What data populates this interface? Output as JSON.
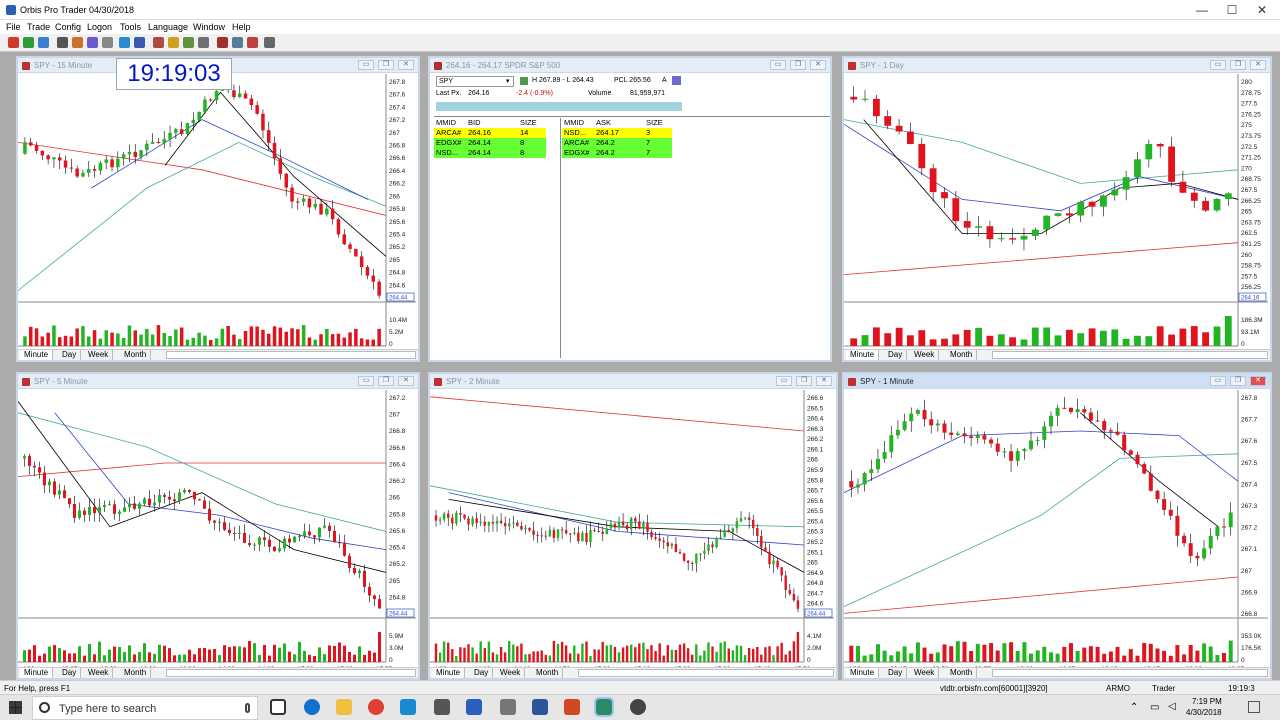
{
  "window": {
    "title": "Orbis Pro Trader  04/30/2018",
    "controls": [
      "—",
      "☐",
      "✕"
    ]
  },
  "menu": [
    "File",
    "Trade",
    "Config",
    "Logon",
    "Tools",
    "Language",
    "Window",
    "Help"
  ],
  "clock": "19:19:03",
  "tabs": [
    "Minute",
    "Day",
    "Week",
    "Month"
  ],
  "panel_buttons": [
    "▭",
    "❐",
    "✕"
  ],
  "panels": {
    "p1": {
      "title": "SPY - 15 Minute",
      "yticks": [
        "267.8",
        "267.6",
        "267.4",
        "267.2",
        "267",
        "266.8",
        "266.6",
        "266.4",
        "266.2",
        "266",
        "265.8",
        "265.6",
        "265.4",
        "265.2",
        "265",
        "264.8",
        "264.6",
        "264.4"
      ],
      "price_tag": "264.44",
      "vol_ticks": [
        "10.4M",
        "5.2M",
        "0"
      ],
      "xticks": [
        "4/27",
        "11:00",
        "13:00",
        "15:00",
        "4/30",
        "11:00",
        "13:00",
        "15:00"
      ]
    },
    "p2": {
      "title": "264.16 - 264.17   SPDR S&P 500"
    },
    "p3": {
      "title": "SPY - 1 Day",
      "yticks": [
        "280",
        "278.75",
        "277.5",
        "276.25",
        "275",
        "273.75",
        "272.5",
        "271.25",
        "270",
        "268.75",
        "267.5",
        "266.25",
        "265",
        "263.75",
        "262.5",
        "261.25",
        "260",
        "258.75",
        "257.5",
        "256.25",
        "255"
      ],
      "price_tag": "264.16",
      "vol_ticks": [
        "186.3M",
        "93.1M",
        "0"
      ],
      "xticks": [
        "3/13",
        "14",
        "15",
        "16",
        "19",
        "20",
        "21",
        "22",
        "23",
        "26",
        "27",
        "28",
        "29",
        "2",
        "3",
        "4",
        "5",
        "6",
        "9",
        "10",
        "11",
        "12",
        "13",
        "16",
        "17",
        "18",
        "19",
        "20",
        "23",
        "24",
        "25",
        "26",
        "27",
        "30"
      ],
      "xnote": "3/18",
      "month_label": "APR"
    },
    "p4": {
      "title": "SPY - 5 Minute",
      "yticks": [
        "267.2",
        "267",
        "266.8",
        "266.6",
        "266.4",
        "266.2",
        "266",
        "265.8",
        "265.6",
        "265.4",
        "265.2",
        "265",
        "264.8",
        "264.6"
      ],
      "price_tag": "264.44",
      "vol_ticks": [
        "5.9M",
        "3.0M",
        "0"
      ],
      "xticks": [
        "4/30",
        "12:05",
        "12:30",
        "13:00",
        "13:30",
        "14:00",
        "14:30",
        "15:00",
        "15:30",
        "15:55"
      ]
    },
    "p5": {
      "title": "SPY - 2 Minute",
      "yticks": [
        "266.6",
        "266.5",
        "266.4",
        "266.3",
        "266.2",
        "266.1",
        "266",
        "265.9",
        "265.8",
        "265.7",
        "265.6",
        "265.5",
        "265.4",
        "265.3",
        "265.2",
        "265.1",
        "265",
        "264.9",
        "264.8",
        "264.7",
        "264.6",
        "264.5"
      ],
      "price_tag": "264.44",
      "vol_ticks": [
        "4.1M",
        "2.0M",
        "0"
      ],
      "xticks": [
        "4/30",
        "14:30",
        "14:40",
        "14:50",
        "15:00",
        "15:10",
        "15:20",
        "15:30",
        "15:40",
        "15:50"
      ]
    },
    "p6": {
      "title": "SPY - 1 Minute",
      "yticks": [
        "267.8",
        "267.7",
        "267.6",
        "267.5",
        "267.4",
        "267.3",
        "267.2",
        "267.1",
        "267",
        "266.9",
        "266.8"
      ],
      "vol_ticks": [
        "353.0K",
        "176.5K",
        "0"
      ],
      "xticks": [
        "4/30",
        "09:45",
        "09:50",
        "09:55",
        "10:00",
        "10:05",
        "10:10",
        "10:15",
        "10:20",
        "10:25"
      ]
    }
  },
  "quote": {
    "symbol": "SPY",
    "high_low": "H 267.89 - L 264.43",
    "pcl": "PCL 265.56",
    "flag": "A",
    "last_label": "Last Px.",
    "last": "264.16",
    "change": "-2.4  (-0.9%)",
    "volume_label": "Volume",
    "volume": "81,959,971",
    "bid_headers": [
      "MMID",
      "BID",
      "SIZE"
    ],
    "bids": [
      [
        "ARCA#",
        "264.16",
        "14"
      ],
      [
        "EDGX#",
        "264.14",
        "8"
      ],
      [
        "NSD...",
        "264.14",
        "8"
      ]
    ],
    "ask_headers": [
      "MMID",
      "ASK",
      "SIZE"
    ],
    "asks": [
      [
        "NSD...",
        "264.17",
        "3"
      ],
      [
        "ARCA#",
        "264.2",
        "7"
      ],
      [
        "EDGX#",
        "264.2",
        "7"
      ]
    ]
  },
  "colors": {
    "up": "#22b422",
    "down": "#e0141e",
    "ma_red": "#e03030",
    "ma_blue": "#3040c8",
    "ma_green": "#40a8a0",
    "ma_black": "#000000",
    "row_yellow": "#ffff00",
    "row_green": "#66ff33"
  },
  "status": {
    "help": "For Help, press F1",
    "server": "vtdtr.orbisfn.com[60001][3920]",
    "account": "ARMO",
    "mode": "Trader",
    "time": "19:19:3"
  },
  "taskbar": {
    "search_placeholder": "Type here to search",
    "time": "7:19 PM",
    "date": "4/30/2018"
  }
}
